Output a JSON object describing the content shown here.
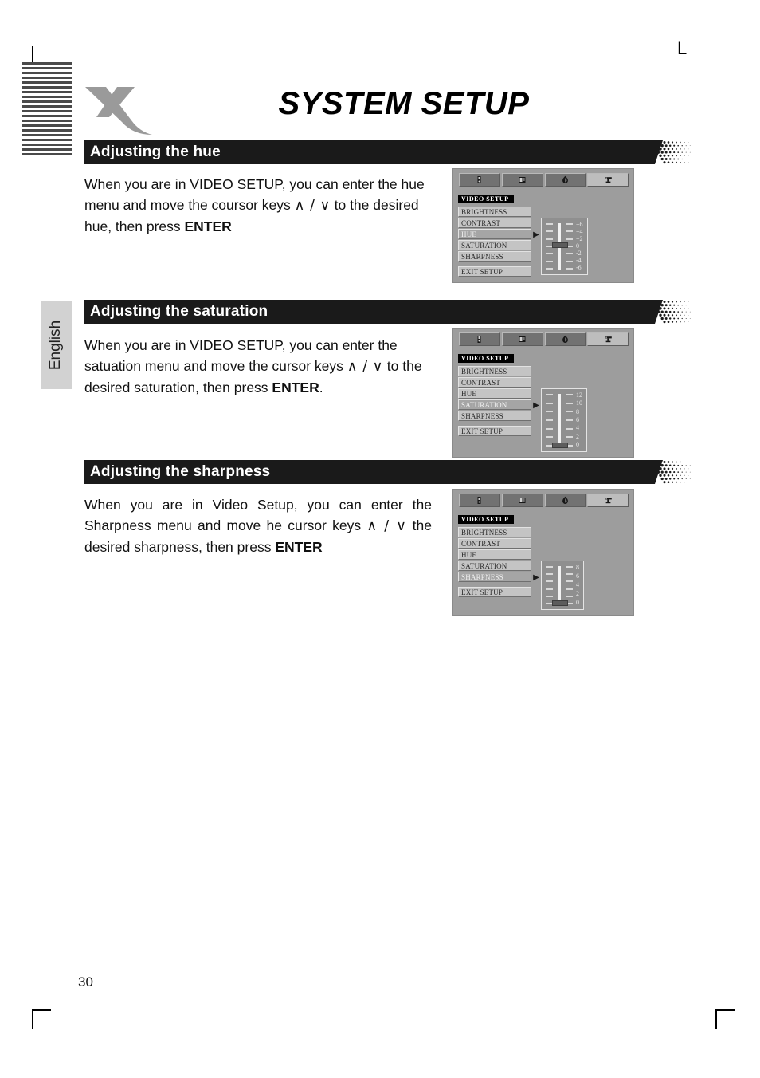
{
  "document": {
    "title": "SYSTEM SETUP",
    "page_number": "30",
    "language_tab": "English",
    "registration_letter": "L",
    "logo_name": "x-logo"
  },
  "sections": [
    {
      "heading": "Adjusting the hue",
      "body_parts": [
        "When you are in VIDEO SETUP, you can enter the hue menu and move the coursor keys ",
        "∧ / ∨",
        " to the desired hue, then press ",
        "ENTER"
      ],
      "justified": false,
      "osd": {
        "title": "VIDEO SETUP",
        "tabs": [
          "general-setup-icon",
          "audio-setup-icon",
          "dolby-setup-icon",
          "video-setup-icon"
        ],
        "active_tab_index": 3,
        "items": [
          "BRIGHTNESS",
          "CONTRAST",
          "HUE",
          "SATURATION",
          "SHARPNESS"
        ],
        "selected_item": "HUE",
        "exit_label": "EXIT SETUP",
        "scale_labels": [
          "+6",
          "+4",
          "+2",
          "0",
          "-2",
          "-4",
          "-6"
        ],
        "tick_count": 7,
        "knob_percent": 50
      }
    },
    {
      "heading": "Adjusting the saturation",
      "body_parts": [
        "When you are in VIDEO SETUP, you can enter the satuation menu and move the cursor keys ",
        "∧ / ∨",
        " to the desired saturation, then press ",
        "ENTER",
        "."
      ],
      "justified": false,
      "osd": {
        "title": "VIDEO SETUP",
        "tabs": [
          "general-setup-icon",
          "audio-setup-icon",
          "dolby-setup-icon",
          "video-setup-icon"
        ],
        "active_tab_index": 3,
        "items": [
          "BRIGHTNESS",
          "CONTRAST",
          "HUE",
          "SATURATION",
          "SHARPNESS"
        ],
        "selected_item": "SATURATION",
        "exit_label": "EXIT SETUP",
        "scale_labels": [
          "12",
          "10",
          "8",
          "6",
          "4",
          "2",
          "0"
        ],
        "tick_count": 7,
        "knob_percent": 100
      }
    },
    {
      "heading": "Adjusting the sharpness",
      "body_parts": [
        "When you are in Video Setup, you can enter the Sharpness menu and move he cursor keys ",
        "∧ / ∨",
        " the desired sharpness, then press ",
        "ENTER"
      ],
      "justified": true,
      "osd": {
        "title": "VIDEO SETUP",
        "tabs": [
          "general-setup-icon",
          "audio-setup-icon",
          "dolby-setup-icon",
          "video-setup-icon"
        ],
        "active_tab_index": 3,
        "items": [
          "BRIGHTNESS",
          "CONTRAST",
          "HUE",
          "SATURATION",
          "SHARPNESS"
        ],
        "selected_item": "SHARPNESS",
        "exit_label": "EXIT SETUP",
        "scale_labels": [
          "8",
          "6",
          "4",
          "2",
          "0"
        ],
        "tick_count": 6,
        "knob_percent": 100
      }
    }
  ],
  "colors": {
    "heading_bar": "#1a1a1a",
    "heading_text": "#ffffff",
    "logo_gray": "#9a9a9a",
    "osd_background": "#9d9d9d",
    "side_tab": "#d2d2d2"
  }
}
